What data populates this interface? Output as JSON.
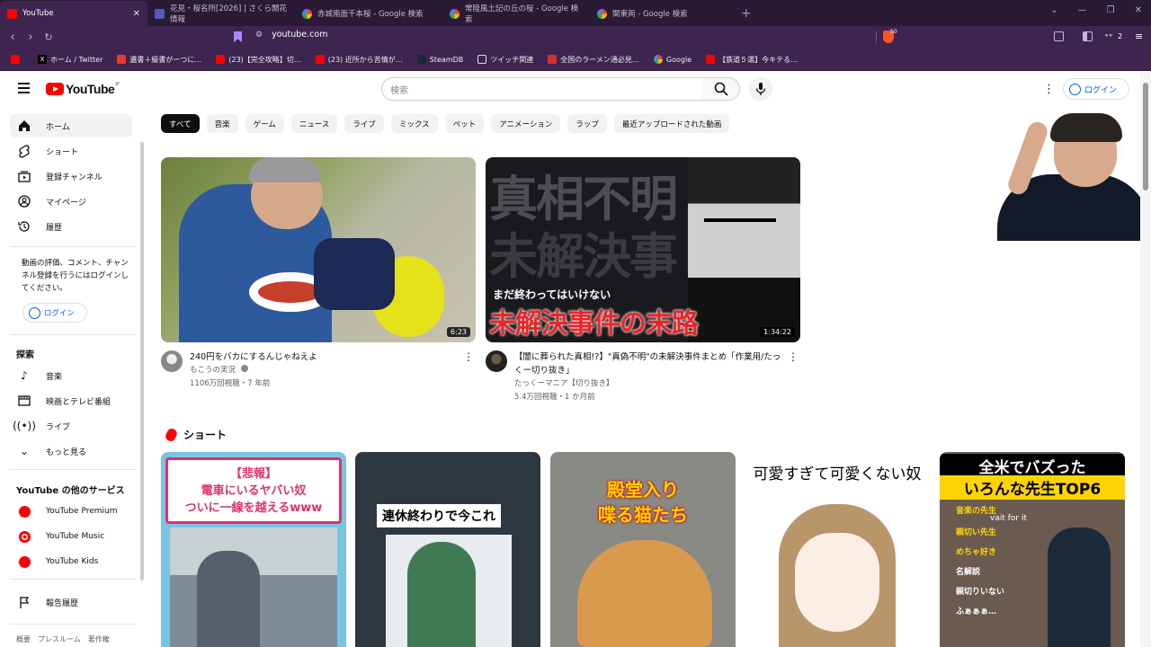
{
  "browser": {
    "tabs": [
      {
        "title": "YouTube",
        "color": "#ff0000"
      },
      {
        "title": "花見・桜名所[2026] | さくら開花情報",
        "color": "#4d5db0"
      },
      {
        "title": "赤城南面千本桜 - Google 検索",
        "color": "#4285f4"
      },
      {
        "title": "常陸風土記の丘の桜 - Google 検索",
        "color": "#4285f4"
      },
      {
        "title": "関東両 - Google 検索",
        "color": "#4285f4"
      }
    ],
    "url": "youtube.com",
    "shield_count": "50",
    "vpn_badge": "2",
    "bookmarks": [
      {
        "label": "",
        "color": "#ff0000"
      },
      {
        "label": "ホーム / Twitter",
        "color": "#000000"
      },
      {
        "label": "遺書＋級書がーつに…",
        "color": "#e53935"
      },
      {
        "label": "(23)【完全攻略】切…",
        "color": "#ff0000"
      },
      {
        "label": "(23) 近所から苦情が…",
        "color": "#ff0000"
      },
      {
        "label": "SteamDB",
        "color": "#1b2838"
      },
      {
        "label": "ツイッチ関連",
        "color": "#9146ff"
      },
      {
        "label": "全国のラーメン通必見…",
        "color": "#d32f2f"
      },
      {
        "label": "Google",
        "color": "#4285f4"
      },
      {
        "label": "【鉄道５選】今キテる…",
        "color": "#ff0000"
      }
    ]
  },
  "masthead": {
    "logo_text": "YouTube",
    "logo_region": "JP",
    "search_placeholder": "検索",
    "signin_label": "ログイン"
  },
  "sidebar": {
    "main_items": [
      {
        "label": "ホーム",
        "icon": "home-icon"
      },
      {
        "label": "ショート",
        "icon": "shorts-icon"
      },
      {
        "label": "登録チャンネル",
        "icon": "subscriptions-icon"
      },
      {
        "label": "マイページ",
        "icon": "you-icon"
      },
      {
        "label": "履歴",
        "icon": "history-icon"
      }
    ],
    "signin_prompt": "動画の評価、コメント、チャンネル登録を行うにはログインしてください。",
    "signin_label": "ログイン",
    "explore_title": "探索",
    "explore_items": [
      {
        "label": "音楽",
        "icon": "music-icon"
      },
      {
        "label": "映画とテレビ番組",
        "icon": "film-icon"
      },
      {
        "label": "ライブ",
        "icon": "live-icon"
      },
      {
        "label": "もっと見る",
        "icon": "chevron-down-icon"
      }
    ],
    "more_title": "YouTube の他のサービス",
    "more_items": [
      {
        "label": "YouTube Premium"
      },
      {
        "label": "YouTube Music"
      },
      {
        "label": "YouTube Kids"
      }
    ],
    "report_label": "報告履歴",
    "footer": "概要　プレスルーム　著作権"
  },
  "chips": [
    "すべて",
    "音楽",
    "ゲーム",
    "ニュース",
    "ライブ",
    "ミックス",
    "ペット",
    "アニメーション",
    "ラップ",
    "最近アップロードされた動画"
  ],
  "videos": [
    {
      "title": "240円をバカにするんじゃねえよ",
      "channel": "もこうの実況",
      "stats": "1106万回視聴・7 年前",
      "duration": "6:23"
    },
    {
      "title": "【闇に葬られた真相!?】\"真偽不明\"の未解決事件まとめ「作業用/たっくー切り抜き」",
      "channel": "たっくーマニア【切り抜き】",
      "stats": "5.4万回視聴・1 か月前",
      "duration": "1:34:22",
      "thumb_text_top": "真相不明",
      "thumb_text_mid": "未解決事",
      "thumb_caption": "まだ終わってはいけない",
      "thumb_headline": "未解決事件の末路"
    }
  ],
  "shorts": {
    "title": "ショート",
    "items": [
      {
        "lines": [
          "【悲報】",
          "電車にいるヤバい奴",
          "ついに一線を越えるwww"
        ]
      },
      {
        "lines": [
          "連休終わりで今これ"
        ]
      },
      {
        "lines": [
          "殿堂入り",
          "喋る猫たち"
        ]
      },
      {
        "lines": [
          "可愛すぎて可愛くない奴"
        ]
      },
      {
        "lines": [
          "全米でバズった",
          "いろんな先生TOP6"
        ],
        "list": [
          "音楽の先生",
          "vait for it",
          "親切い先生",
          "めちゃ好き",
          "名解説",
          "親切りいない",
          "ふぁぁぁ…"
        ]
      }
    ]
  }
}
